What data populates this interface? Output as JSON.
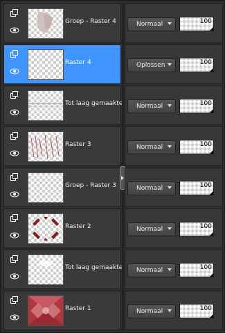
{
  "layers": [
    {
      "name": "Groep - Raster 4",
      "blend": "Normaal",
      "opacity": "100",
      "selected": false
    },
    {
      "name": "Raster 4",
      "blend": "Oplossen",
      "opacity": "100",
      "selected": true
    },
    {
      "name": "Tot laag gemaakte se",
      "blend": "Normaal",
      "opacity": "100",
      "selected": false
    },
    {
      "name": "Raster 3",
      "blend": "Normaal",
      "opacity": "100",
      "selected": false
    },
    {
      "name": "Groep - Raster 3",
      "blend": "Normaal",
      "opacity": "100",
      "selected": false
    },
    {
      "name": "Raster 2",
      "blend": "Normaal",
      "opacity": "100",
      "selected": false
    },
    {
      "name": "Tot laag gemaakte se",
      "blend": "Normaal",
      "opacity": "100",
      "selected": false
    },
    {
      "name": "Raster 1",
      "blend": "Normaal",
      "opacity": "100",
      "selected": false
    }
  ],
  "colors": {
    "accent": "#3f94ff",
    "panel": "#2e2e2e",
    "row": "#3a3a3a",
    "dark_red": "#8b1a1f"
  },
  "icons": {
    "visibility": "layer-mode-icon",
    "eye": "eye-icon",
    "expand": "chevron-right-icon"
  }
}
